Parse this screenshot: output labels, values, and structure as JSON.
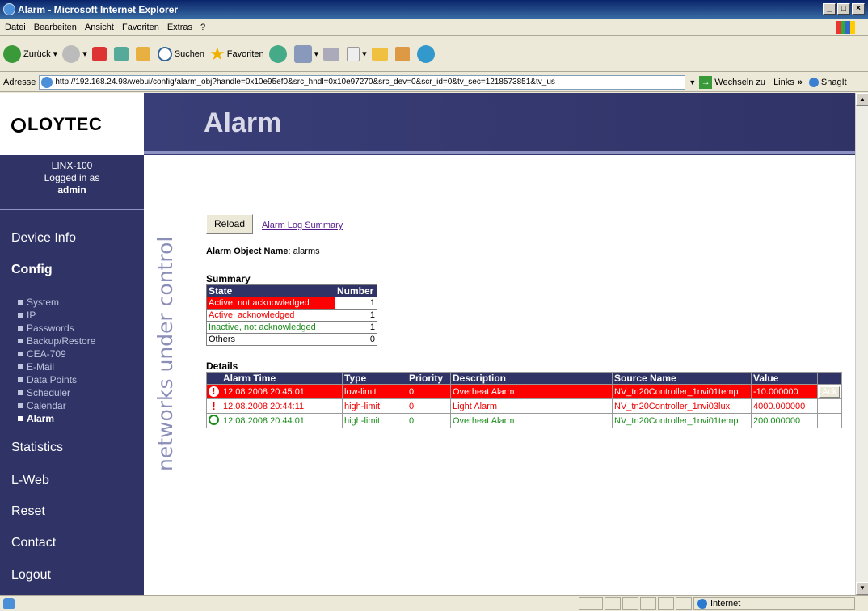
{
  "window": {
    "title": "Alarm - Microsoft Internet Explorer"
  },
  "menu": [
    "Datei",
    "Bearbeiten",
    "Ansicht",
    "Favoriten",
    "Extras",
    "?"
  ],
  "toolbar": {
    "back": "Zurück",
    "search": "Suchen",
    "favorites": "Favoriten"
  },
  "address": {
    "label": "Adresse",
    "url": "http://192.168.24.98/webui/config/alarm_obj?handle=0x10e95ef0&src_hndl=0x10e97270&src_dev=0&scr_id=0&tv_sec=1218573851&tv_us",
    "go": "Wechseln zu",
    "links": "Links",
    "snagit": "SnagIt"
  },
  "status": {
    "zone": "Internet"
  },
  "brand": {
    "logo": "LOYTEC",
    "tagline": "networks under control"
  },
  "page": {
    "title": "Alarm"
  },
  "device": {
    "model": "LINX-100",
    "logged_in": "Logged in as",
    "user": "admin"
  },
  "nav": {
    "device_info": "Device Info",
    "config": "Config",
    "config_items": [
      "System",
      "IP",
      "Passwords",
      "Backup/Restore",
      "CEA-709",
      "E-Mail",
      "Data Points",
      "Scheduler",
      "Calendar",
      "Alarm"
    ],
    "statistics": "Statistics",
    "lweb": "L-Web",
    "reset": "Reset",
    "contact": "Contact",
    "logout": "Logout"
  },
  "actions": {
    "reload": "Reload",
    "log_summary": "Alarm Log Summary"
  },
  "object": {
    "label": "Alarm Object Name",
    "value": ": alarms"
  },
  "summary": {
    "heading": "Summary",
    "headers": [
      "State",
      "Number"
    ],
    "rows": [
      {
        "state": "Active, not acknowledged",
        "number": "1"
      },
      {
        "state": "Active, acknowledged",
        "number": "1"
      },
      {
        "state": "Inactive, not acknowledged",
        "number": "1"
      },
      {
        "state": "Others",
        "number": "0"
      }
    ]
  },
  "details": {
    "heading": "Details",
    "headers": [
      "Alarm Time",
      "Type",
      "Priority",
      "Description",
      "Source Name",
      "Value"
    ],
    "rows": [
      {
        "time": "12.08.2008 20:45:01",
        "type": "low-limit",
        "priority": "0",
        "description": "Overheat Alarm",
        "source": "NV_tn20Controller_1nvi01temp",
        "value": "-10.000000",
        "ack": "Ack"
      },
      {
        "time": "12.08.2008 20:44:11",
        "type": "high-limit",
        "priority": "0",
        "description": "Light Alarm",
        "source": "NV_tn20Controller_1nvi03lux",
        "value": "4000.000000"
      },
      {
        "time": "12.08.2008 20:44:01",
        "type": "high-limit",
        "priority": "0",
        "description": "Overheat Alarm",
        "source": "NV_tn20Controller_1nvi01temp",
        "value": "200.000000"
      }
    ]
  },
  "colors": {
    "brand_navy": "#2f3366",
    "alarm_red": "#ff0000",
    "ok_green": "#1a8c1a"
  }
}
